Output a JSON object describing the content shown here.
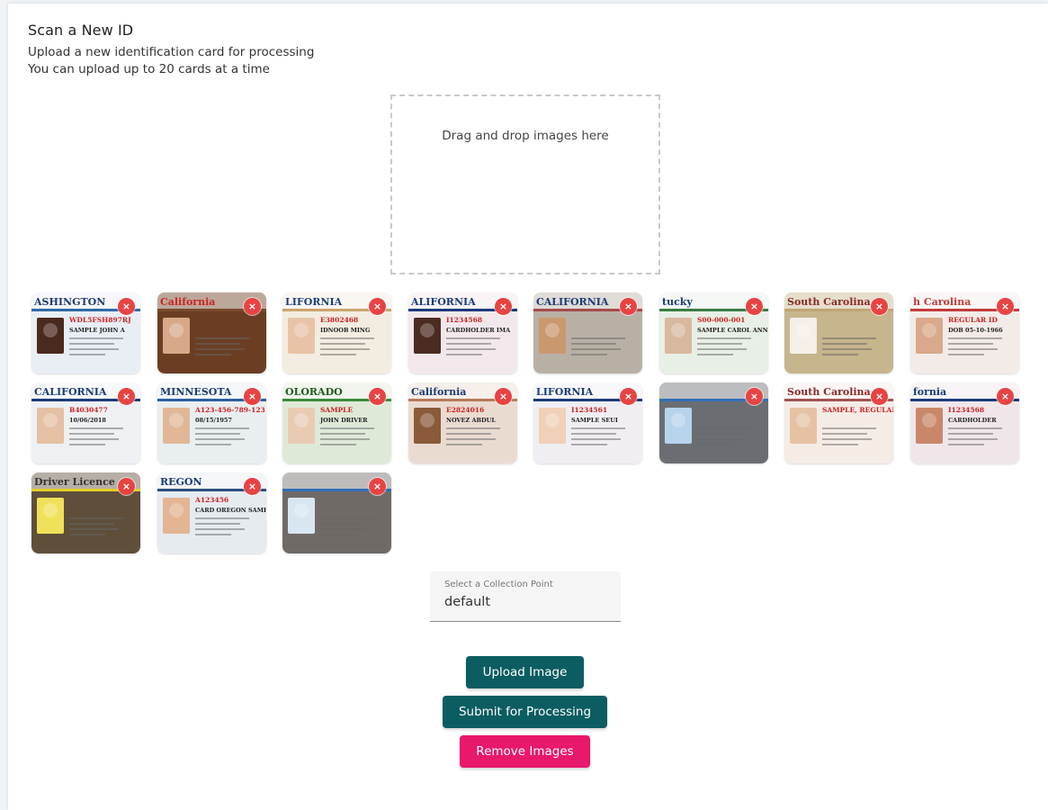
{
  "header": {
    "title": "Scan a New ID",
    "subtitle_line1": "Upload a new identification card for processing",
    "subtitle_line2": "You can upload up to 20 cards at a time"
  },
  "dropzone": {
    "text": "Drag and drop images here"
  },
  "thumbnails": [
    {
      "name": "washington-license",
      "caption": "ASHINGTON",
      "line1": "WDL5FSH897RJ",
      "line2": "SAMPLE JOHN A",
      "band": "#2e6aa6",
      "bg": "#e9eef5",
      "face": "#4a2a1c",
      "caption_color": "#1d3c6e",
      "remove": "×"
    },
    {
      "name": "california-license-photo",
      "caption": "California",
      "line1": "",
      "line2": "",
      "band": "#7a4a2c",
      "bg": "#6b3e23",
      "face": "#d9a889",
      "caption_color": "#c22",
      "remove": "×"
    },
    {
      "name": "california-license-2",
      "caption": "LIFORNIA",
      "line1": "E3802468",
      "line2": "IDNOOB MING",
      "band": "#c9a56d",
      "bg": "#f3ece0",
      "face": "#e8c3a8",
      "caption_color": "#1c3f7a",
      "remove": "×"
    },
    {
      "name": "california-license-3",
      "caption": "ALIFORNIA",
      "line1": "I1234568",
      "line2": "CARDHOLDER IMA",
      "band": "#1b3b78",
      "bg": "#f2e8ec",
      "face": "#4b2b22",
      "caption_color": "#1b3b78",
      "remove": "×"
    },
    {
      "name": "california-license-4",
      "caption": "CALIFORNIA",
      "line1": "",
      "line2": "",
      "band": "#a54b4b",
      "bg": "#b9b0a5",
      "face": "#c9986f",
      "caption_color": "#1b3b78",
      "remove": "×"
    },
    {
      "name": "kentucky-license",
      "caption": "tucky",
      "line1": "S00-000-001",
      "line2": "SAMPLE CAROL ANN",
      "band": "#3b7c44",
      "bg": "#e8efe6",
      "face": "#d9b8a0",
      "caption_color": "#1d3c6e",
      "remove": "×"
    },
    {
      "name": "south-carolina-card",
      "caption": "South Carolina",
      "line1": "",
      "line2": "",
      "band": "#bfa575",
      "bg": "#c7b58c",
      "face": "#f4efe7",
      "caption_color": "#8a2a2a",
      "remove": "×"
    },
    {
      "name": "north-carolina-id",
      "caption": "h Carolina",
      "line1": "REGULAR ID",
      "line2": "DOB 05-10-1966",
      "band": "#c23b3b",
      "bg": "#f3ebe8",
      "face": "#d8a98a",
      "caption_color": "#c23b3b",
      "remove": "×"
    },
    {
      "name": "california-license-5",
      "caption": "CALIFORNIA",
      "line1": "B4030477",
      "line2": "10/06/2018",
      "band": "#1b3b78",
      "bg": "#eef0f4",
      "face": "#e5c0a3",
      "caption_color": "#1b3b78",
      "remove": "×"
    },
    {
      "name": "minnesota-license",
      "caption": "MINNESOTA",
      "line1": "A123-456-789-123",
      "line2": "08/15/1957",
      "band": "#2b5f9e",
      "bg": "#e9eef0",
      "face": "#e0b898",
      "caption_color": "#1b3b78",
      "remove": "×"
    },
    {
      "name": "colorado-license",
      "caption": "OLORADO",
      "line1": "SAMPLE",
      "line2": "JOHN DRIVER",
      "band": "#3b8a3b",
      "bg": "#dfe9d8",
      "face": "#e9cbb4",
      "caption_color": "#1e5a1e",
      "remove": "×"
    },
    {
      "name": "california-license-6",
      "caption": "California",
      "line1": "E2824016",
      "line2": "NOVEZ ABDUL",
      "band": "#b57a5a",
      "bg": "#eadbd1",
      "face": "#8a5a3a",
      "caption_color": "#1b3b78",
      "remove": "×"
    },
    {
      "name": "california-license-7",
      "caption": "LIFORNIA",
      "line1": "I1234561",
      "line2": "SAMPLE SEUI",
      "band": "#1b3b78",
      "bg": "#f0eef3",
      "face": "#f0d0b8",
      "caption_color": "#1b3b78",
      "remove": "×"
    },
    {
      "name": "id-card-held",
      "caption": "",
      "line1": "",
      "line2": "",
      "band": "#2f6fb8",
      "bg": "#6a6e73",
      "face": "#b8d3ec",
      "caption_color": "#2f6fb8",
      "remove": "×"
    },
    {
      "name": "south-carolina-license",
      "caption": "South Carolina",
      "line1": "SAMPLE, REGULAR LICENSE",
      "line2": "",
      "band": "#a05252",
      "bg": "#f5ece6",
      "face": "#e6c2a4",
      "caption_color": "#8a2a2a",
      "remove": "×"
    },
    {
      "name": "california-license-8",
      "caption": "fornia",
      "line1": "I1234568",
      "line2": "CARDHOLDER",
      "band": "#1b3b78",
      "bg": "#f0e6ea",
      "face": "#c9876a",
      "caption_color": "#1b3b78",
      "remove": "×"
    },
    {
      "name": "driver-licence-yellow",
      "caption": "Driver Licence",
      "line1": "",
      "line2": "",
      "band": "#e4cf2a",
      "bg": "#5e4e3a",
      "face": "#f0e15a",
      "caption_color": "#333",
      "remove": "×"
    },
    {
      "name": "oregon-license",
      "caption": "REGON",
      "line1": "A123456",
      "line2": "CARD OREGON SAMPLE, SR",
      "band": "#2b4f7e",
      "bg": "#e6ebf0",
      "face": "#e2b594",
      "caption_color": "#1b3b78",
      "remove": "×"
    },
    {
      "name": "id-card-held-2",
      "caption": "",
      "line1": "",
      "line2": "",
      "band": "#2f6fb8",
      "bg": "#6f6a66",
      "face": "#d8e6f2",
      "caption_color": "#2f6fb8",
      "remove": "×"
    }
  ],
  "collection_point": {
    "label": "Select a Collection Point",
    "value": "default"
  },
  "buttons": {
    "upload": "Upload Image",
    "submit": "Submit for Processing",
    "remove": "Remove Images"
  }
}
